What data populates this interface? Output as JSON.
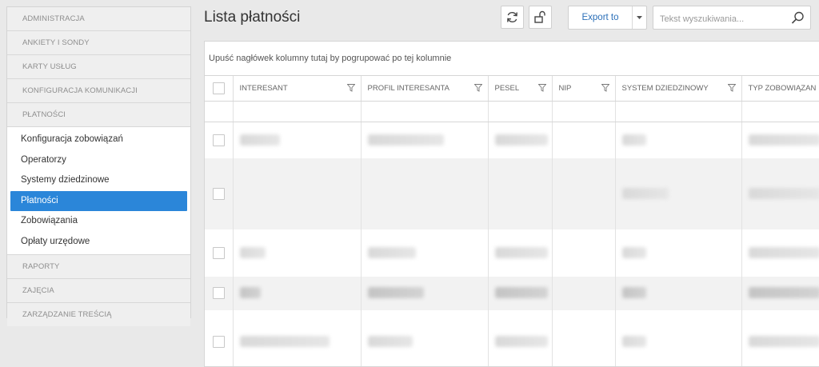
{
  "sidebar": {
    "sections": [
      {
        "label": "ADMINISTRACJA"
      },
      {
        "label": "ANKIETY I SONDY"
      },
      {
        "label": "KARTY USŁUG"
      },
      {
        "label": "KONFIGURACJA KOMUNIKACJI"
      },
      {
        "label": "PŁATNOŚCI"
      },
      {
        "label": "RAPORTY"
      },
      {
        "label": "ZAJĘCIA"
      },
      {
        "label": "ZARZĄDZANIE TREŚCIĄ"
      }
    ],
    "items": [
      {
        "label": "Konfiguracja zobowiązań"
      },
      {
        "label": "Operatorzy"
      },
      {
        "label": "Systemy dziedzinowe"
      },
      {
        "label": "Płatności"
      },
      {
        "label": "Zobowiązania"
      },
      {
        "label": "Opłaty urzędowe"
      }
    ]
  },
  "header": {
    "title": "Lista płatności",
    "refresh_icon": "refresh-icon",
    "unlock_icon": "unlock-icon",
    "export_label": "Export to",
    "search_placeholder": "Tekst wyszukiwania..."
  },
  "grid": {
    "group_panel_text": "Upuść nagłówek kolumny tutaj by pogrupować po tej kolumnie",
    "columns": [
      {
        "label": "INTERESANT"
      },
      {
        "label": "PROFIL INTERESANTA"
      },
      {
        "label": "PESEL"
      },
      {
        "label": "NIP"
      },
      {
        "label": "SYSTEM DZIEDZINOWY"
      },
      {
        "label": "TYP ZOBOWIĄZAN"
      }
    ],
    "row_count_visible": 5,
    "accent_color": "#2b86d9"
  }
}
